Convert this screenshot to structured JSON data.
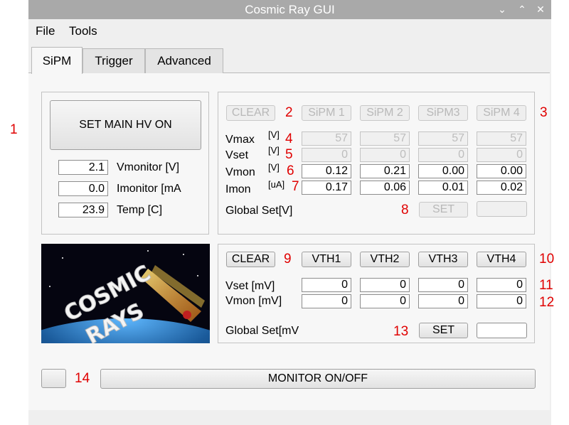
{
  "window": {
    "title": "Cosmic Ray GUI",
    "controls": [
      "⌄",
      "⌃",
      "✕"
    ]
  },
  "menu": {
    "items": [
      "File",
      "Tools"
    ]
  },
  "tabs": [
    "SiPM",
    "Trigger",
    "Advanced"
  ],
  "hv": {
    "main_button": "SET MAIN HV ON",
    "readouts": [
      {
        "value": "2.1",
        "label": "Vmonitor [V]"
      },
      {
        "value": "0.0",
        "label": "Imonitor [mA"
      },
      {
        "value": "23.9",
        "label": "Temp [C]"
      }
    ]
  },
  "sipm": {
    "clear_label": "CLEAR",
    "channels": [
      "SiPM 1",
      "SiPM 2",
      "SiPM3",
      "SiPM 4"
    ],
    "rows": [
      {
        "name": "Vmax",
        "unit": "[V]",
        "values": [
          "57",
          "57",
          "57",
          "57"
        ],
        "disabled": true
      },
      {
        "name": "Vset",
        "unit": "[V]",
        "values": [
          "0",
          "0",
          "0",
          "0"
        ],
        "disabled": true
      },
      {
        "name": "Vmon",
        "unit": "[V]",
        "values": [
          "0.12",
          "0.21",
          "0.00",
          "0.00"
        ],
        "disabled": false
      },
      {
        "name": "Imon",
        "unit": "[uA]",
        "values": [
          "0.17",
          "0.06",
          "0.01",
          "0.02"
        ],
        "disabled": false
      }
    ],
    "global_label": "Global Set[V]",
    "set_label": "SET",
    "global_value": ""
  },
  "threshold": {
    "clear_label": "CLEAR",
    "channels": [
      "VTH1",
      "VTH2",
      "VTH3",
      "VTH4"
    ],
    "rows": [
      {
        "label": "Vset [mV]",
        "values": [
          "0",
          "0",
          "0",
          "0"
        ]
      },
      {
        "label": "Vmon [mV]",
        "values": [
          "0",
          "0",
          "0",
          "0"
        ]
      }
    ],
    "global_label": "Global Set[mV",
    "set_label": "SET",
    "global_value": ""
  },
  "logo": {
    "text": [
      "COSMIC",
      "RAYS"
    ]
  },
  "monitor": {
    "button_label": "MONITOR ON/OFF"
  },
  "annotations": [
    "1",
    "2",
    "3",
    "4",
    "5",
    "6",
    "7",
    "8",
    "9",
    "10",
    "11",
    "12",
    "13",
    "14"
  ],
  "colors": {
    "annotation": "#e00000",
    "titlebar": "#a9a9a9"
  }
}
